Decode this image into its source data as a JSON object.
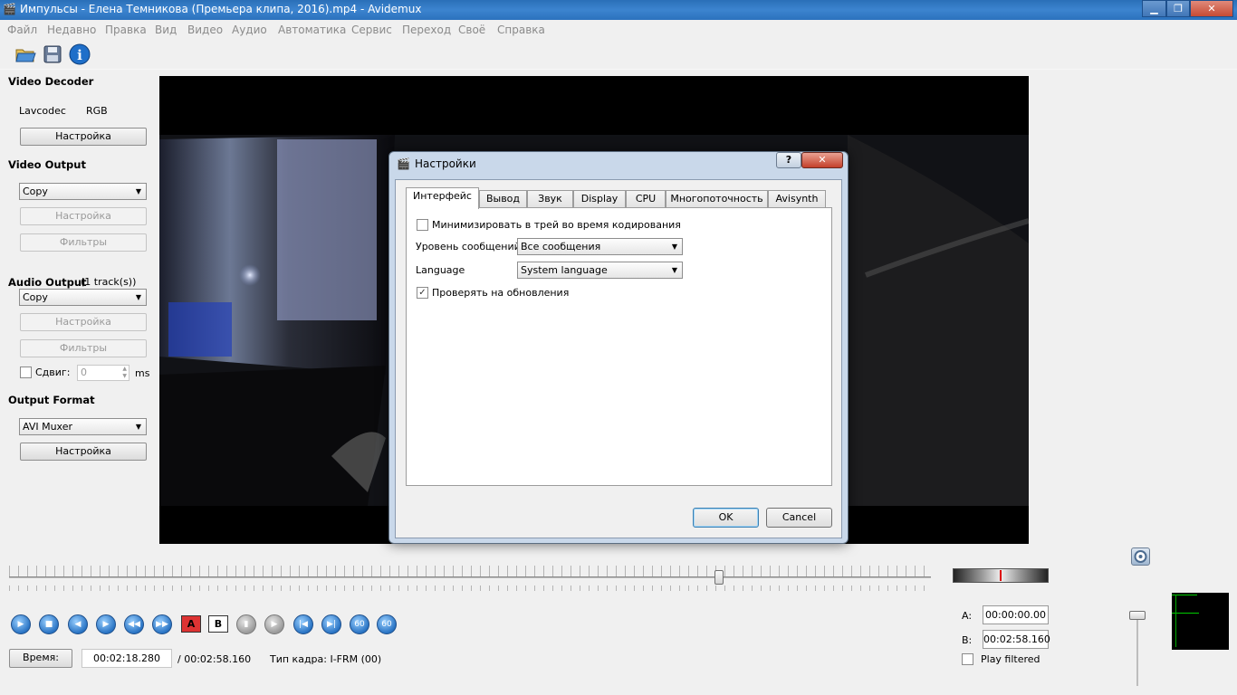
{
  "window": {
    "title": "Импульсы - Елена Темникова (Премьера клипа, 2016).mp4 - Avidemux"
  },
  "menu": [
    "Файл",
    "Недавно",
    "Правка",
    "Вид",
    "Видео",
    "Аудио",
    "Автоматика",
    "Сервис",
    "Переход",
    "Своё",
    "Справка"
  ],
  "left": {
    "video_decoder": {
      "title": "Video Decoder",
      "codec": "Lavcodec",
      "format": "RGB",
      "config": "Настройка"
    },
    "video_output": {
      "title": "Video Output",
      "value": "Copy",
      "config": "Настройка",
      "filters": "Фильтры"
    },
    "audio_output": {
      "title": "Audio Output",
      "tracks": "(1 track(s))",
      "value": "Copy",
      "config": "Настройка",
      "filters": "Фильтры",
      "shift_label": "Сдвиг:",
      "shift_value": "0",
      "shift_unit": "ms"
    },
    "output_format": {
      "title": "Output Format",
      "value": "AVI Muxer",
      "config": "Настройка"
    }
  },
  "dialog": {
    "title": "Настройки",
    "help": "?",
    "close": "✕",
    "tabs": [
      "Интерфейс",
      "Вывод",
      "Звук",
      "Display",
      "CPU",
      "Многопоточность",
      "Avisynth"
    ],
    "active_tab": "Интерфейс",
    "minimize_tray": {
      "label": "Минимизировать в трей во время кодирования",
      "checked": false
    },
    "message_level": {
      "label": "Уровень сообщений:",
      "value": "Все сообщения"
    },
    "language": {
      "label": "Language",
      "value": "System language"
    },
    "check_updates": {
      "label": "Проверять на обновления",
      "checked": true
    },
    "ok": "OK",
    "cancel": "Cancel"
  },
  "bottom": {
    "time_button": "Время:",
    "current_time": "00:02:18.280",
    "total_time": "/ 00:02:58.160",
    "frame_type": "Тип кадра:  I-FRM (00)",
    "marker_a_label": "A:",
    "marker_a": "00:00:00.00",
    "marker_b_label": "B:",
    "marker_b": "00:02:58.160",
    "play_filtered": "Play filtered",
    "play_filtered_checked": false,
    "seek_position": 0.77
  },
  "colors": {
    "titlebar": "#3c84cf",
    "accent": "#2a74c4"
  }
}
